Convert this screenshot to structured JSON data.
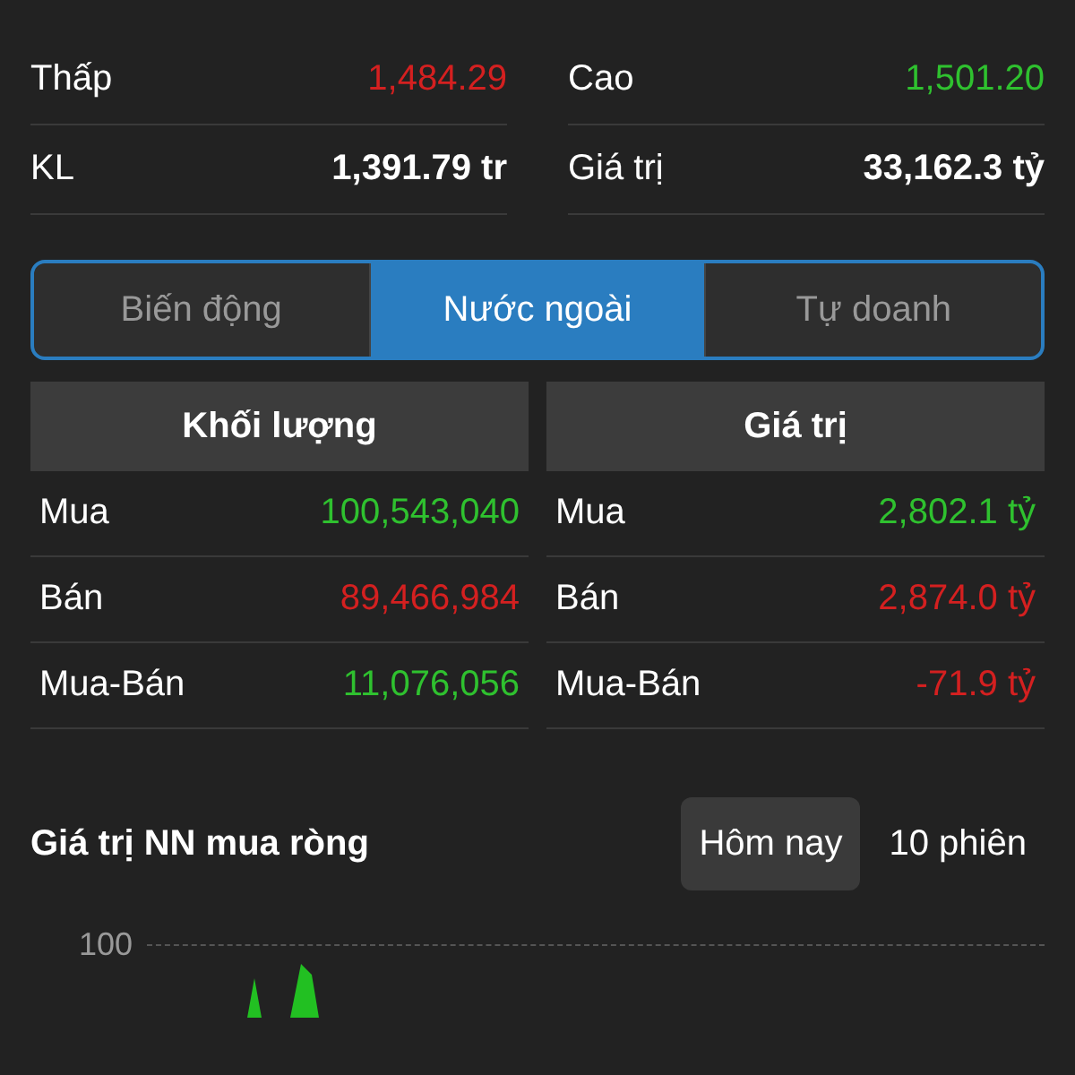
{
  "stats": [
    {
      "left": {
        "label": "Thấp",
        "value": "1,484.29",
        "color": "#d42020"
      },
      "right": {
        "label": "Cao",
        "value": "1,501.20",
        "color": "#2fc12f"
      }
    },
    {
      "left": {
        "label": "KL",
        "value": "1,391.79 tr",
        "color": "#ffffff"
      },
      "right": {
        "label": "Giá trị",
        "value": "33,162.3 tỷ",
        "color": "#ffffff"
      }
    }
  ],
  "tabs": [
    {
      "label": "Biến động",
      "selected": false
    },
    {
      "label": "Nước ngoài",
      "selected": true
    },
    {
      "label": "Tự doanh",
      "selected": false
    }
  ],
  "tables": [
    {
      "header": "Khối lượng",
      "rows": [
        {
          "label": "Mua",
          "value": "100,543,040",
          "color": "#2fc12f"
        },
        {
          "label": "Bán",
          "value": "89,466,984",
          "color": "#d42020"
        },
        {
          "label": "Mua-Bán",
          "value": "11,076,056",
          "color": "#2fc12f"
        }
      ]
    },
    {
      "header": "Giá trị",
      "rows": [
        {
          "label": "Mua",
          "value": "2,802.1 tỷ",
          "color": "#2fc12f"
        },
        {
          "label": "Bán",
          "value": "2,874.0 tỷ",
          "color": "#d42020"
        },
        {
          "label": "Mua-Bán",
          "value": "-71.9 tỷ",
          "color": "#d42020"
        }
      ]
    }
  ],
  "chart": {
    "title": "Giá trị NN mua ròng",
    "periods": [
      {
        "label": "Hôm nay",
        "selected": true
      },
      {
        "label": "10 phiên",
        "selected": false
      }
    ],
    "tick": "100"
  }
}
